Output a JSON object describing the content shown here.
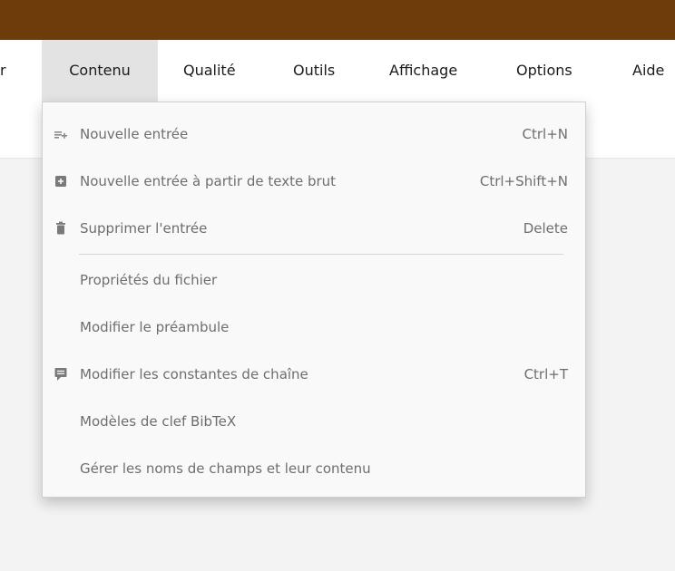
{
  "menubar": {
    "items": [
      {
        "label": "r"
      },
      {
        "label": "Contenu",
        "active": true
      },
      {
        "label": "Qualité"
      },
      {
        "label": "Outils"
      },
      {
        "label": "Affichage"
      },
      {
        "label": "Options"
      },
      {
        "label": "Aide"
      }
    ]
  },
  "dropdown": {
    "items": [
      {
        "label": "Nouvelle entrée",
        "shortcut": "Ctrl+N",
        "icon": "new-entry-icon"
      },
      {
        "label": "Nouvelle entrée à partir de texte brut",
        "shortcut": "Ctrl+Shift+N",
        "icon": "add-box-icon"
      },
      {
        "label": "Supprimer l'entrée",
        "shortcut": "Delete",
        "icon": "trash-icon"
      },
      {
        "label": "Propriétés du fichier",
        "shortcut": ""
      },
      {
        "label": "Modifier le préambule",
        "shortcut": ""
      },
      {
        "label": "Modifier les constantes de chaîne",
        "shortcut": "Ctrl+T",
        "icon": "message-icon"
      },
      {
        "label": "Modèles de clef BibTeX",
        "shortcut": ""
      },
      {
        "label": "Gérer les noms de champs et leur contenu",
        "shortcut": ""
      }
    ]
  },
  "colors": {
    "titlebar": "#6d3c0a",
    "menu_text": "#6e6e6e",
    "active_tab": "#e3e3e3"
  }
}
